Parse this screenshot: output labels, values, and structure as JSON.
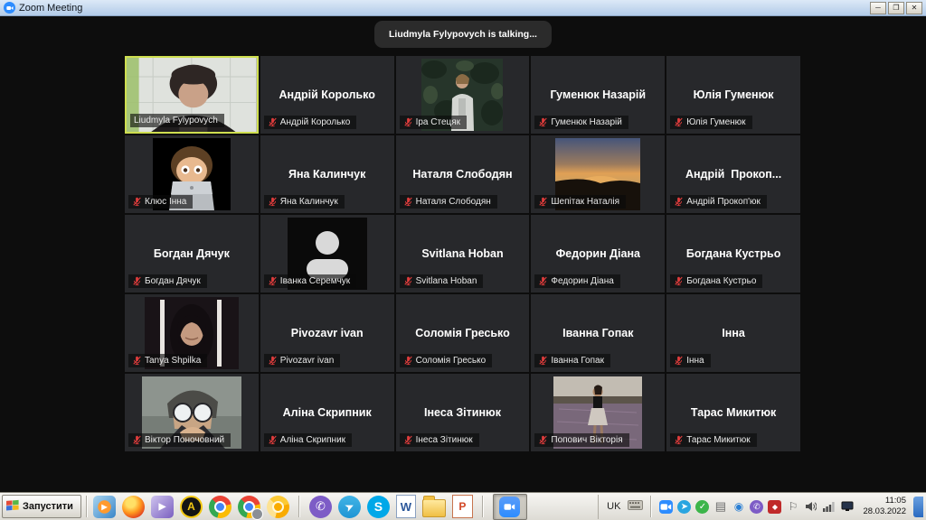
{
  "window": {
    "title": "Zoom Meeting",
    "controls": [
      {
        "name": "minimize-button",
        "glyph": "─"
      },
      {
        "name": "restore-button",
        "glyph": "❐"
      },
      {
        "name": "close-button",
        "glyph": "✕"
      }
    ]
  },
  "meeting": {
    "toast": "Liudmyla Fylypovych is talking...",
    "active_border_color": "#cede4f",
    "mic_muted_color": "#e03c3c"
  },
  "participants": [
    {
      "label": "Liudmyla Fylypovych",
      "avatar": "video-woman",
      "muted": false,
      "active": true
    },
    {
      "center": "Андрій Королько",
      "label": "Андрій Королько",
      "muted": true
    },
    {
      "label": "Іра Стецяк",
      "avatar": "foliage",
      "muted": true
    },
    {
      "center": "Гуменюк Назарій",
      "label": "Гуменюк Назарій",
      "muted": true
    },
    {
      "center": "Юлія Гуменюк",
      "label": "Юлія Гуменюк",
      "muted": true
    },
    {
      "label": "Клюс Інна",
      "avatar": "memoji",
      "muted": true
    },
    {
      "center": "Яна Калинчук",
      "label": "Яна Калинчук",
      "muted": true
    },
    {
      "center": "Наталя Слободян",
      "label": "Наталя Слободян",
      "muted": true
    },
    {
      "label": "Шепітак Наталія",
      "avatar": "sunset",
      "muted": true
    },
    {
      "center": "Андрій  Прокоп...",
      "label": "Андрій Прокоп'юк",
      "muted": true
    },
    {
      "center": "Богдан Дячук",
      "label": "Богдан Дячук",
      "muted": true
    },
    {
      "label": "Іванка Серемчук",
      "avatar": "silhouette",
      "muted": true
    },
    {
      "center": "Svitlana Hoban",
      "label": "Svitlana Hoban",
      "muted": true
    },
    {
      "center": "Федорин Діана",
      "label": "Федорин Діана",
      "muted": true
    },
    {
      "center": "Богдана Кустрьо",
      "label": "Богдана Кустрьо",
      "muted": true
    },
    {
      "label": "Tanya Shpilka",
      "avatar": "selfie",
      "muted": true
    },
    {
      "center": "Pivozavr ivan",
      "label": "Pivozavr ivan",
      "muted": true
    },
    {
      "center": "Соломія Гресько",
      "label": "Соломія Гресько",
      "muted": true
    },
    {
      "center": "Іванна Гопак",
      "label": "Іванна Гопак",
      "muted": true
    },
    {
      "center": "Інна",
      "label": "Інна",
      "muted": true
    },
    {
      "label": "Віктор Поночовний",
      "avatar": "anime",
      "muted": true
    },
    {
      "center": "Аліна Скрипник",
      "label": "Аліна Скрипник",
      "muted": true
    },
    {
      "center": "Інеса Зітинюк",
      "label": "Інеса Зітинюк",
      "muted": true
    },
    {
      "label": "Попович Вікторія",
      "avatar": "field",
      "muted": true
    },
    {
      "center": "Тарас Микитюк",
      "label": "Тарас Микитюк",
      "muted": true
    }
  ],
  "taskbar": {
    "start_label": "Запустити",
    "quick_launch": [
      {
        "name": "media-player-icon",
        "cls": "ql-wmp",
        "glyph": "▶"
      },
      {
        "name": "firefox-icon",
        "cls": "ql-firefox"
      },
      {
        "name": "kmplayer-icon",
        "cls": "ql-kmp",
        "glyph": "▶"
      },
      {
        "name": "aimp-icon",
        "cls": "ql-aimp",
        "glyph": "A"
      },
      {
        "name": "chrome-icon",
        "cls": "ql-chrome",
        "dot": "chrome"
      },
      {
        "name": "chrome-profile-icon",
        "cls": "ql-chrome",
        "dot": "chrome",
        "badge": true
      },
      {
        "name": "chrome-canary-icon",
        "cls": "ql-canary",
        "dot": "canary"
      },
      {
        "sep": true
      },
      {
        "name": "viber-icon",
        "cls": "ql-viber",
        "glyph": "✆"
      },
      {
        "name": "telegram-icon",
        "cls": "ql-telegram",
        "glyph": "➤"
      },
      {
        "name": "skype-icon",
        "cls": "ql-skype",
        "glyph": "S"
      },
      {
        "name": "word-icon",
        "cls": "ql-word",
        "glyph": "W"
      },
      {
        "name": "file-manager-icon",
        "cls": "ql-folder"
      },
      {
        "name": "powerpoint-icon",
        "cls": "ql-ppt",
        "glyph": "P"
      },
      {
        "sep": true
      },
      {
        "name": "zoom-taskbar-button",
        "cls": "ql-zoom",
        "svg": "camera",
        "pressed": true
      }
    ],
    "tray": {
      "language": "UK",
      "icons": [
        {
          "name": "zoom-tray-icon",
          "cls": "tr-zoom",
          "svg": "camera"
        },
        {
          "name": "telegram-tray-icon",
          "cls": "tr-telegram",
          "glyph": "➤"
        },
        {
          "name": "checkmark-tray-icon",
          "cls": "tr-check",
          "glyph": "✓"
        },
        {
          "name": "clipboard-tray-icon",
          "cls": "tr-clip",
          "glyph": "▤"
        },
        {
          "name": "eye-tray-icon",
          "cls": "tr-eye",
          "glyph": "◉"
        },
        {
          "name": "viber-tray-icon",
          "cls": "tr-viber",
          "glyph": "✆"
        },
        {
          "name": "antivirus-tray-icon",
          "cls": "tr-red",
          "glyph": "◆"
        },
        {
          "name": "flag-tray-icon",
          "cls": "tr-flag",
          "glyph": "⚐"
        },
        {
          "name": "volume-tray-icon",
          "cls": "tr-mono",
          "svg": "speaker"
        },
        {
          "name": "network-tray-icon",
          "cls": "tr-mono",
          "svg": "network"
        },
        {
          "name": "display-tray-icon",
          "cls": "tr-dark",
          "svg": "monitor"
        }
      ],
      "clock": {
        "time": "11:05",
        "date": "28.03.2022"
      }
    }
  }
}
